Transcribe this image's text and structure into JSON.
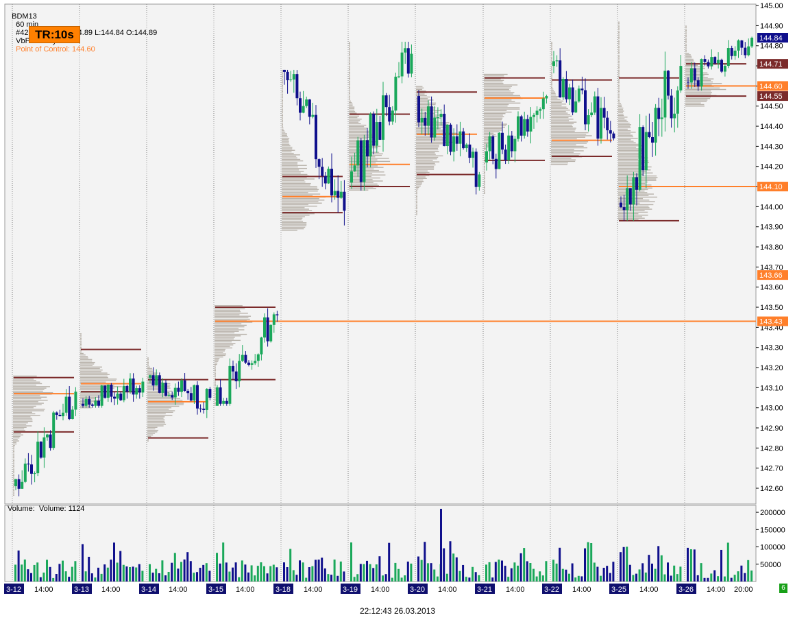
{
  "header": {
    "symbol": "BDM13",
    "interval": "60 min",
    "bar_info": "#42 21:59:50 H:144.89 L:144.84 O:144.89",
    "indicator": "VbP - 1 Days:",
    "poc_label": "Point of Control: 144.60"
  },
  "tr_badge": "TR:10s",
  "volume_title": "Volume:  Volume: 1124",
  "status_badge": "6",
  "footer_time": "22:12:43 26.03.2013",
  "colors": {
    "bull": "#1aa85a",
    "bear": "#0f0f8c",
    "poc": "#ff7f2a",
    "value_area": "#7b2a2a",
    "profile": "#b8b2aa",
    "grid": "#9a9a9a",
    "badge": "#ff8000",
    "status": "#18a018"
  },
  "chart_data": {
    "type": "candlestick",
    "ylim": [
      142.55,
      145.0
    ],
    "y_ticks": [
      "145.00",
      "144.90",
      "144.80",
      "144.70",
      "144.60",
      "144.50",
      "144.40",
      "144.30",
      "144.20",
      "144.10",
      "144.00",
      "143.90",
      "143.80",
      "143.70",
      "143.60",
      "143.50",
      "143.40",
      "143.30",
      "143.20",
      "143.10",
      "143.00",
      "142.90",
      "142.80",
      "142.70",
      "142.60"
    ],
    "x_labels": [
      "3-12",
      "14:00",
      "3-13",
      "14:00",
      "3-14",
      "14:00",
      "3-15",
      "14:00",
      "3-18",
      "14:00",
      "3-19",
      "14:00",
      "3-20",
      "14:00",
      "3-21",
      "14:00",
      "3-22",
      "14:00",
      "3-25",
      "14:00",
      "3-26",
      "14:00",
      "20:00"
    ],
    "price_tags": [
      {
        "value": 144.84,
        "label": "144.84",
        "kind": "last"
      },
      {
        "value": 144.71,
        "label": "144.71",
        "kind": "va"
      },
      {
        "value": 144.6,
        "label": "144.60",
        "kind": "poc"
      },
      {
        "value": 144.55,
        "label": "144.55",
        "kind": "va"
      },
      {
        "value": 144.1,
        "label": "144.10",
        "kind": "poc"
      },
      {
        "value": 143.66,
        "label": "143.66",
        "kind": "poc"
      },
      {
        "value": 143.43,
        "label": "143.43",
        "kind": "poc"
      }
    ],
    "days": [
      {
        "date": "3-12",
        "open": 142.61,
        "close": 143.08,
        "high": 143.16,
        "low": 142.56,
        "poc": 143.07,
        "vah": 143.15,
        "val": 142.88,
        "ext": false
      },
      {
        "date": "3-13",
        "open": 143.02,
        "close": 143.13,
        "high": 143.37,
        "low": 143.0,
        "poc": 143.12,
        "vah": 143.29,
        "val": 143.08,
        "ext": false
      },
      {
        "date": "3-14",
        "open": 143.15,
        "close": 143.05,
        "high": 143.25,
        "low": 142.83,
        "poc": 143.03,
        "vah": 143.14,
        "val": 142.85,
        "ext": false
      },
      {
        "date": "3-15",
        "open": 143.01,
        "close": 143.46,
        "high": 143.51,
        "low": 143.01,
        "poc": 143.43,
        "vah": 143.5,
        "val": 143.14,
        "ext": true
      },
      {
        "date": "3-18",
        "open": 144.68,
        "close": 143.98,
        "high": 144.68,
        "low": 143.88,
        "poc": 144.05,
        "vah": 144.15,
        "val": 143.97,
        "ext": false
      },
      {
        "date": "3-19",
        "open": 144.12,
        "close": 144.76,
        "high": 144.82,
        "low": 144.08,
        "poc": 144.21,
        "vah": 144.46,
        "val": 144.1,
        "ext": false
      },
      {
        "date": "3-20",
        "open": 144.55,
        "close": 144.16,
        "high": 144.6,
        "low": 143.96,
        "poc": 144.36,
        "vah": 144.57,
        "val": 144.16,
        "ext": false
      },
      {
        "date": "3-21",
        "open": 144.22,
        "close": 144.55,
        "high": 144.66,
        "low": 144.06,
        "poc": 144.54,
        "vah": 144.64,
        "val": 144.23,
        "ext": false
      },
      {
        "date": "3-22",
        "open": 144.7,
        "close": 144.34,
        "high": 144.82,
        "low": 144.21,
        "poc": 144.33,
        "vah": 144.63,
        "val": 144.25,
        "ext": false
      },
      {
        "date": "3-25",
        "open": 144.02,
        "close": 144.7,
        "high": 144.92,
        "low": 143.93,
        "poc": 144.1,
        "vah": 144.64,
        "val": 143.93,
        "ext": true
      },
      {
        "date": "3-26",
        "open": 144.62,
        "close": 144.84,
        "high": 144.9,
        "low": 144.5,
        "poc": 144.6,
        "vah": 144.71,
        "val": 144.55,
        "ext": true
      }
    ],
    "volume": {
      "y_ticks": [
        "200000",
        "150000",
        "100000",
        "50000"
      ],
      "ylim": [
        0,
        220000
      ],
      "last": 1124
    }
  }
}
